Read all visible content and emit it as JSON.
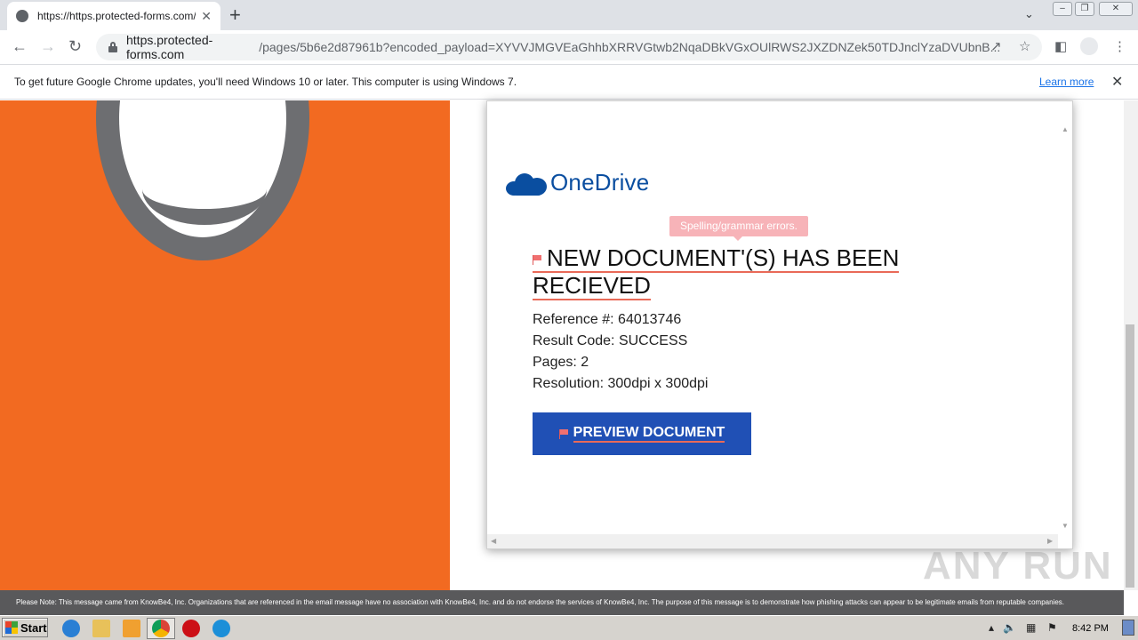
{
  "browser": {
    "tab_title": "https://https.protected-forms.com/p",
    "tab_close": "✕",
    "new_tab": "+",
    "url_host": "https.protected-forms.com",
    "url_path": "/pages/5b6e2d87961b?encoded_payload=XYVVJMGVEaGhhbXRRVGtwb2NqaDBkVGxOUlRWS2JXZDNZek50TDJnclYzaDVUbnB...",
    "info_message": "To get future Google Chrome updates, you'll need Windows 10 or later. This computer is using Windows 7.",
    "info_link": "Learn more"
  },
  "page": {
    "brand": "OneDrive",
    "tooltip": "Spelling/grammar errors.",
    "headline_line1": "NEW   DOCUMENT'(S) HAS BEEN",
    "headline_line2": "RECIEVED",
    "reference": "Reference #: 64013746",
    "result": "Result Code: SUCCESS",
    "pages": "Pages: 2",
    "resolution": "Resolution: 300dpi x 300dpi",
    "button": "PREVIEW DOCUMENT",
    "disclaimer": "Please Note: This message came from KnowBe4, Inc. Organizations that are referenced in the email message have no association with KnowBe4, Inc. and do not endorse the services of KnowBe4, Inc. The purpose of this message is to demonstrate how phishing attacks can appear to be legitimate emails from reputable companies.",
    "watermark": "ANY RUN"
  },
  "taskbar": {
    "start": "Start",
    "clock": "8:42 PM"
  },
  "colors": {
    "orange_panel": "#f26a21",
    "onedrive_blue": "#0a4ea0",
    "button_blue": "#2050b5",
    "tooltip_pink": "#f7b3b8"
  }
}
